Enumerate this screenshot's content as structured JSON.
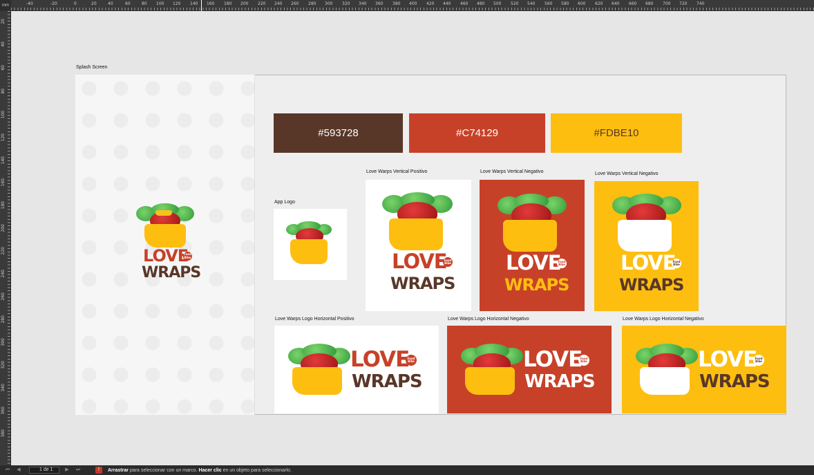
{
  "ruler": {
    "unit": "mm",
    "top_ticks": [
      "-40",
      "-20",
      "0",
      "20",
      "40",
      "60",
      "80",
      "100",
      "120",
      "140",
      "160",
      "180",
      "200",
      "220",
      "240",
      "260",
      "280",
      "300",
      "320",
      "340",
      "360",
      "380",
      "400",
      "420",
      "440",
      "460",
      "480",
      "500",
      "520",
      "540",
      "560",
      "580",
      "600",
      "620",
      "640",
      "660",
      "680",
      "700",
      "720",
      "740"
    ],
    "left_ticks": [
      "20",
      "40",
      "60",
      "80",
      "100",
      "120",
      "140",
      "160",
      "180",
      "200",
      "220",
      "240",
      "260",
      "280",
      "300",
      "320",
      "340",
      "360",
      "380"
    ]
  },
  "artboard": {
    "label": "Splash Screen"
  },
  "swatches": [
    {
      "hex": "#593728",
      "label": "#593728"
    },
    {
      "hex": "#C74129",
      "label": "#C74129"
    },
    {
      "hex": "#FDBE10",
      "label": "#FDBE10"
    }
  ],
  "captions": {
    "app_logo": "App Logo",
    "vertical_positive": "Love Warps Vertical Positivo",
    "vertical_negative_red": "Love Warps Vertical Negativo",
    "vertical_negative_yellow": "Love Warps Vertical Negativo",
    "horizontal_positive": "Love Warps Logo Horizontal Positivo",
    "horizontal_negative_red": "Love Warps Logo Horizontal Negativo",
    "horizontal_negative_yellow": "Love Warps Logo Horizontal Negativo"
  },
  "logo": {
    "word_top": "LOVE",
    "word_bottom": "WRAPS",
    "badge": "Food Bike"
  },
  "colors": {
    "brown": "#593728",
    "red": "#C74129",
    "yellow": "#FDBE10",
    "white": "#FFFFFF"
  },
  "statusbar": {
    "page": "1 de 1",
    "drag_bold": "Arrastrar",
    "drag_text": " para seleccionar con un marco. ",
    "click_bold": "Hacer clic",
    "click_text": " en un objeto para seleccionarlo."
  }
}
